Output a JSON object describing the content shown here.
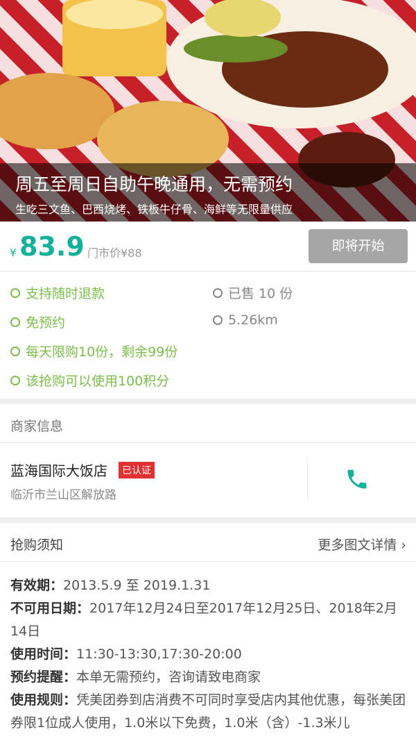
{
  "hero": {
    "title": "周五至周日自助午晚通用，无需预约",
    "subtitle": "生吃三文鱼、巴西烧烤、铁板牛仔骨、海鲜等无限量供应"
  },
  "price": {
    "currency": "¥",
    "amount": "83.9",
    "original": "门市价¥88",
    "button": "即将开始"
  },
  "features": [
    {
      "label": "支持随时退款",
      "color": "#7cbd4b"
    },
    {
      "label": "已售 10 份",
      "color": "#888888"
    },
    {
      "label": "免预约",
      "color": "#7cbd4b"
    },
    {
      "label": "5.26km",
      "color": "#888888"
    },
    {
      "label": "每天限购10份，剩余99份",
      "color": "#7cbd4b"
    },
    {
      "label": "该抢购可以使用100积分",
      "color": "#7cbd4b"
    }
  ],
  "merchant": {
    "section_title": "商家信息",
    "name": "蓝海国际大饭店",
    "badge": "已认证",
    "address": "临沂市兰山区解放路",
    "phone_icon": "phone-icon"
  },
  "notice": {
    "section_title": "抢购须知",
    "more": "更多图文详情",
    "rules": [
      {
        "key": "有效期：",
        "value": "2013.5.9 至 2019.1.31"
      },
      {
        "key": "不可用日期：",
        "value": "2017年12月24日至2017年12月25日、2018年2月14日"
      },
      {
        "key": "使用时间：",
        "value": "11:30-13:30,17:30-20:00"
      },
      {
        "key": "预约提醒：",
        "value": "本单无需预约，咨询请致电商家"
      },
      {
        "key": "使用规则：",
        "value": "凭美团券到店消费不可同时享受店内其他优惠，每张美团券限1位成人使用，1.0米以下免费，1.0米（含）-1.3米儿"
      }
    ]
  },
  "colors": {
    "accent": "#13b09b",
    "feature_green": "#7cbd4b",
    "badge_red": "#e23030"
  }
}
